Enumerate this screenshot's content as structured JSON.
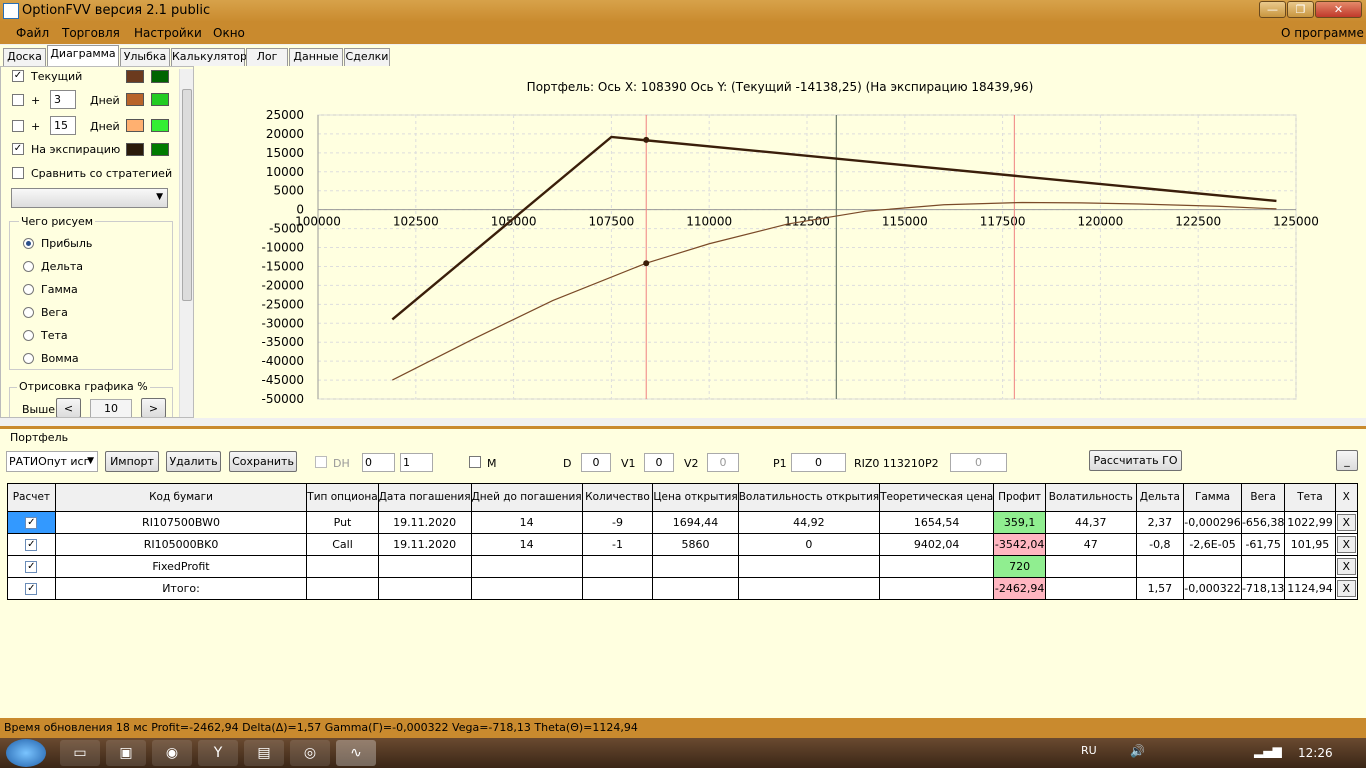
{
  "window": {
    "title": "OptionFVV версия 2.1 public",
    "min": "—",
    "max": "❐",
    "close": "✕"
  },
  "menu": {
    "file": "Файл",
    "trade": "Торговля",
    "settings": "Настройки",
    "window": "Окно",
    "about": "О программе"
  },
  "tabs": [
    "Доска",
    "Диаграмма",
    "Улыбка",
    "Калькулятор",
    "Лог",
    "Данные",
    "Сделки"
  ],
  "left": {
    "current": "Текущий",
    "plus": "+",
    "days": "Дней",
    "days1": "3",
    "days2": "15",
    "expiry": "На экспирацию",
    "compare": "Сравнить со стратегией",
    "group": "Чего рисуем",
    "radios": [
      "Прибыль",
      "Дельта",
      "Гамма",
      "Вега",
      "Тета",
      "Вомма"
    ],
    "draw_group": "Отрисовка графика %",
    "above": "Выше",
    "lt": "<",
    "gt": ">",
    "above_val": "10"
  },
  "colors": {
    "c_current_1": "#6b3a1e",
    "c_current_2": "#006400",
    "c_d3_1": "#b8642a",
    "c_d3_2": "#22cc22",
    "c_d15_1": "#ffb070",
    "c_d15_2": "#33ee33",
    "c_exp_1": "#2a1a0a",
    "c_exp_2": "#007a00"
  },
  "chart_title": "Портфель: Ось X:  108390 Ось Y:  (Текущий -14138,25)  (На экспирацию 18439,96)",
  "chart_data": {
    "type": "line",
    "xlim": [
      100000,
      125000
    ],
    "ylim": [
      -50000,
      25000
    ],
    "xticks": [
      "100000",
      "102500",
      "105000",
      "107500",
      "110000",
      "112500",
      "115000",
      "117500",
      "120000",
      "122500",
      "125000"
    ],
    "yticks": [
      "25000",
      "20000",
      "15000",
      "10000",
      "5000",
      "0",
      "-5000",
      "-10000",
      "-15000",
      "-20000",
      "-25000",
      "-30000",
      "-35000",
      "-40000",
      "-45000",
      "-50000"
    ],
    "cursor_x": 108390,
    "current_marker": {
      "x": 108390,
      "y": -14138.25
    },
    "expiry_marker": {
      "x": 108390,
      "y": 18439.96
    },
    "red_lines": [
      108390,
      117800
    ],
    "gray_line": 113250,
    "series": [
      {
        "x": [
          101900,
          107500,
          124500
        ],
        "y": [
          -29000,
          19200,
          2300
        ],
        "color": "#3a1e0a",
        "width": 2.4
      },
      {
        "x": [
          101900,
          104000,
          106000,
          108390,
          110000,
          112000,
          114000,
          116000,
          118000,
          119500,
          121000,
          123000,
          124500
        ],
        "y": [
          -45000,
          -34000,
          -24000,
          -14138,
          -9000,
          -3800,
          -400,
          1300,
          1900,
          1800,
          1500,
          900,
          200
        ],
        "color": "#7a4a28",
        "width": 1.2
      }
    ]
  },
  "portfolio": {
    "title": "Портфель",
    "combo": "РАТИОпут исг",
    "import": "Импорт",
    "delete": "Удалить",
    "save": "Сохранить",
    "dh": "DH",
    "spin1": "0",
    "spin2": "1",
    "m": "M",
    "d": "D",
    "d_val": "0",
    "v1": "V1",
    "v1_val": "0",
    "v2": "V2",
    "v2_val": "0",
    "p1": "P1",
    "p1_val": "0",
    "riz": "RIZ0 113210",
    "p2": "P2",
    "p2_val": "0",
    "calc_go": "Рассчитать ГО",
    "minimize": "_"
  },
  "grid": {
    "headers": [
      "Расчет",
      "Код бумаги",
      "Тип опциона",
      "Дата погашения",
      "Дней до погашения",
      "Количество",
      "Цена открытия",
      "Волатильность открытия",
      "Теоретическая цена",
      "Профит",
      "Волатильность",
      "Дельта",
      "Гамма",
      "Вега",
      "Тета",
      "X"
    ],
    "rows": [
      [
        "✓",
        "RI107500BW0",
        "Put",
        "19.11.2020",
        "14",
        "-9",
        "1694,44",
        "44,92",
        "1654,54",
        "359,1",
        "44,37",
        "2,37",
        "-0,000296",
        "-656,38",
        "1022,99",
        "X"
      ],
      [
        "✓",
        "RI105000BK0",
        "Call",
        "19.11.2020",
        "14",
        "-1",
        "5860",
        "0",
        "9402,04",
        "-3542,04",
        "47",
        "-0,8",
        "-2,6E-05",
        "-61,75",
        "101,95",
        "X"
      ],
      [
        "✓",
        "FixedProfit",
        "",
        "",
        "",
        "",
        "",
        "",
        "",
        "720",
        "",
        "",
        "",
        "",
        "",
        "X"
      ],
      [
        "✓",
        "Итого:",
        "",
        "",
        "",
        "",
        "",
        "",
        "",
        "-2462,94",
        "",
        "1,57",
        "-0,000322",
        "-718,13",
        "1124,94",
        "X"
      ]
    ]
  },
  "status": "Время обновления 18 мс  Profit=-2462,94 Delta(Δ)=1,57 Gamma(Γ)=-0,000322 Vega=-718,13 Theta(Θ)=1124,94",
  "taskbar": {
    "lang": "RU",
    "clock": "12:26"
  }
}
